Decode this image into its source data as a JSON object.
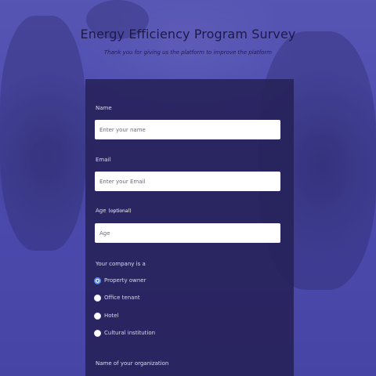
{
  "header": {
    "title": "Energy Efficiency Program Survey",
    "subtitle": "Thank you for giving us the platform to improve the platform"
  },
  "form": {
    "name": {
      "label": "Name",
      "placeholder": "Enter your name"
    },
    "email": {
      "label": "Email",
      "placeholder": "Enter your Email"
    },
    "age": {
      "label": "Age",
      "optional": "(optional)",
      "placeholder": "Age"
    },
    "company": {
      "label": "Your company is a",
      "options": [
        "Property owner",
        "Office tenant",
        "Hotel",
        "Cultural institution"
      ],
      "selected": "Property owner"
    },
    "organization": {
      "label": "Name of your organization"
    }
  },
  "colors": {
    "panel": "#262158",
    "radio_accent": "#2f6be0",
    "title": "#1d1a4a"
  }
}
